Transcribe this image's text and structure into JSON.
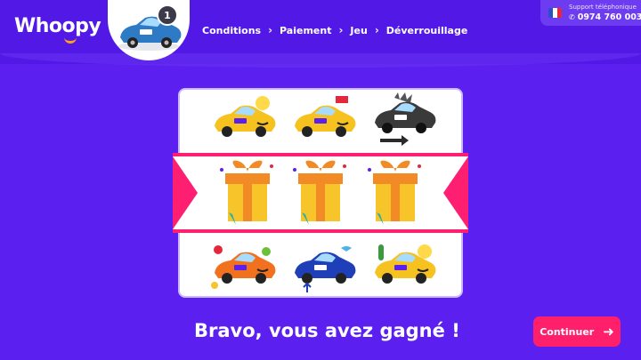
{
  "header": {
    "logo_text": "Whoopy",
    "step_badge": "1",
    "breadcrumb": [
      {
        "label": "Conditions"
      },
      {
        "label": "Paiement"
      },
      {
        "label": "Jeu"
      },
      {
        "label": "Déverrouillage"
      }
    ],
    "separator": "›"
  },
  "support": {
    "label": "Support téléphonique",
    "phone": "0974 760 003",
    "phone_icon": "phone-icon",
    "flag_icon": "france-flag-icon"
  },
  "game": {
    "top_row": [
      "yellow-car-sun",
      "yellow-car-flag",
      "black-car-arrow"
    ],
    "winning_row": [
      "gift-box",
      "gift-box",
      "gift-box"
    ],
    "bottom_row": [
      "orange-car-fruit",
      "blue-car-sea",
      "yellow-car-cactus"
    ]
  },
  "result": {
    "message": "Bravo, vous avez gagné !"
  },
  "actions": {
    "continue_label": "Continuer",
    "continue_icon": "arrow-right-icon"
  },
  "colors": {
    "background": "#5b1ff0",
    "accent": "#ff1f6b",
    "gift_yellow": "#f7c52a",
    "gift_orange": "#f28b25"
  }
}
